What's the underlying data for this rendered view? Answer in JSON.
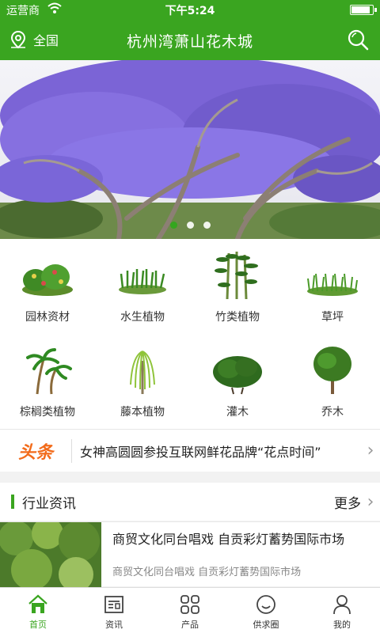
{
  "status_bar": {
    "carrier": "运营商",
    "time": "下午5:24",
    "battery_level": 0.9
  },
  "nav": {
    "location": "全国",
    "title": "杭州湾萧山花木城",
    "search_icon": "search-icon",
    "location_icon": "location-pin-icon"
  },
  "banner": {
    "slide_count": 3,
    "active_slide": 1
  },
  "categories": [
    {
      "label": "园林资材",
      "icon": "garden-shrub-icon"
    },
    {
      "label": "水生植物",
      "icon": "aquatic-plant-icon"
    },
    {
      "label": "竹类植物",
      "icon": "bamboo-icon"
    },
    {
      "label": "草坪",
      "icon": "grass-icon"
    },
    {
      "label": "棕榈类植物",
      "icon": "palm-tree-icon"
    },
    {
      "label": "藤本植物",
      "icon": "willow-tree-icon"
    },
    {
      "label": "灌木",
      "icon": "shrub-icon"
    },
    {
      "label": "乔木",
      "icon": "tree-icon"
    }
  ],
  "headline": {
    "tag": "头条",
    "text": "女神高圆圆参投互联网鲜花品牌“花点时间”"
  },
  "industry": {
    "title": "行业资讯",
    "more": "更多"
  },
  "news": [
    {
      "title": "商贸文化同台唱戏 自贡彩灯蓄势国际市场",
      "subtitle": "商贸文化同台唱戏 自贡彩灯蓄势国际市场"
    }
  ],
  "tabs": [
    {
      "label": "首页",
      "icon": "home-icon",
      "active": true
    },
    {
      "label": "资讯",
      "icon": "news-icon",
      "active": false
    },
    {
      "label": "产品",
      "icon": "grid-icon",
      "active": false
    },
    {
      "label": "供求圈",
      "icon": "smile-icon",
      "active": false
    },
    {
      "label": "我的",
      "icon": "user-icon",
      "active": false
    }
  ],
  "colors": {
    "brand_green": "#3aa520",
    "headline_orange": "#f26b1a"
  }
}
